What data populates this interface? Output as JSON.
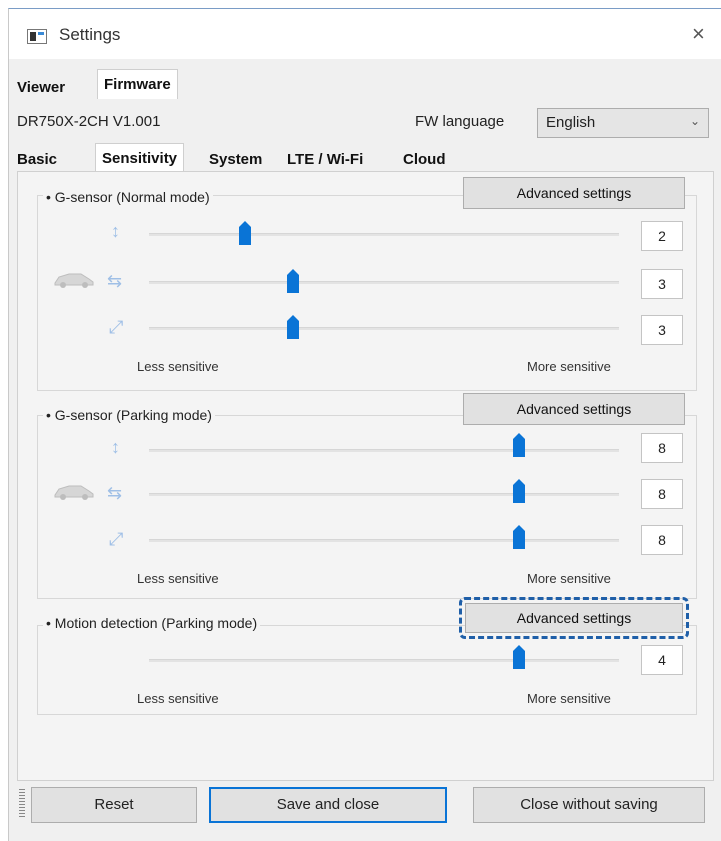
{
  "window": {
    "title": "Settings",
    "close_glyph": "×"
  },
  "main_tabs": [
    {
      "label": "Viewer"
    },
    {
      "label": "Firmware"
    }
  ],
  "firmware": {
    "model_version": "DR750X-2CH  V1.001"
  },
  "fw_language": {
    "label": "FW language",
    "value": "English"
  },
  "sub_tabs": [
    {
      "label": "Basic"
    },
    {
      "label": "Sensitivity"
    },
    {
      "label": "System"
    },
    {
      "label": "LTE / Wi-Fi"
    },
    {
      "label": "Cloud"
    }
  ],
  "groups": {
    "normal": {
      "title": "• G-sensor (Normal mode)",
      "advanced_label": "Advanced settings",
      "sliders": [
        {
          "axis": "vertical-axis-icon",
          "level": 2,
          "value": "2"
        },
        {
          "axis": "lateral-axis-icon",
          "level": 3,
          "value": "3"
        },
        {
          "axis": "diagonal-axis-icon",
          "level": 3,
          "value": "3"
        }
      ],
      "less_label": "Less sensitive",
      "more_label": "More sensitive"
    },
    "parking": {
      "title": "• G-sensor (Parking mode)",
      "advanced_label": "Advanced settings",
      "sliders": [
        {
          "axis": "vertical-axis-icon",
          "level": 8,
          "value": "8"
        },
        {
          "axis": "lateral-axis-icon",
          "level": 8,
          "value": "8"
        },
        {
          "axis": "diagonal-axis-icon",
          "level": 8,
          "value": "8"
        }
      ],
      "less_label": "Less sensitive",
      "more_label": "More sensitive"
    },
    "motion": {
      "title": "• Motion detection (Parking mode)",
      "advanced_label": "Advanced settings",
      "slider": {
        "level": 4,
        "value": "4"
      },
      "less_label": "Less sensitive",
      "more_label": "More sensitive"
    }
  },
  "footer": {
    "reset_label": "Reset",
    "save_label": "Save and close",
    "close_label": "Close without saving"
  },
  "colors": {
    "accent": "#0a74d6",
    "highlight": "#1f5fa8"
  }
}
